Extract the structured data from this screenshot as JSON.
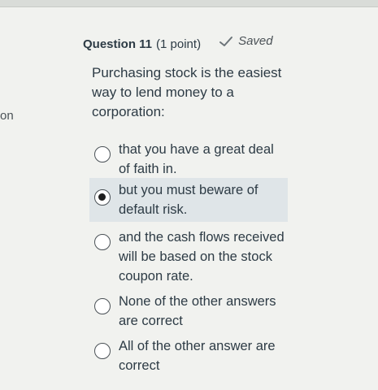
{
  "sidebar": {
    "edge_label": "on"
  },
  "question": {
    "number_label": "Question 11",
    "points_label": "(1 point)",
    "saved_label": "Saved",
    "text": "Purchasing stock is the easiest way to lend money to a corporation:",
    "selected_index": 1,
    "options": [
      {
        "label": "that you have a great deal of faith in."
      },
      {
        "label": "but you must beware of default risk."
      },
      {
        "label": "and the cash flows received will be based on the stock coupon rate."
      },
      {
        "label": "None of the other answers are correct"
      },
      {
        "label": "All of the other answer are correct"
      }
    ]
  },
  "icons": {
    "saved": "checkmark-icon",
    "radio": "radio-icon"
  },
  "colors": {
    "selected_background": "#dfe5e8",
    "text": "#2d3b45"
  }
}
